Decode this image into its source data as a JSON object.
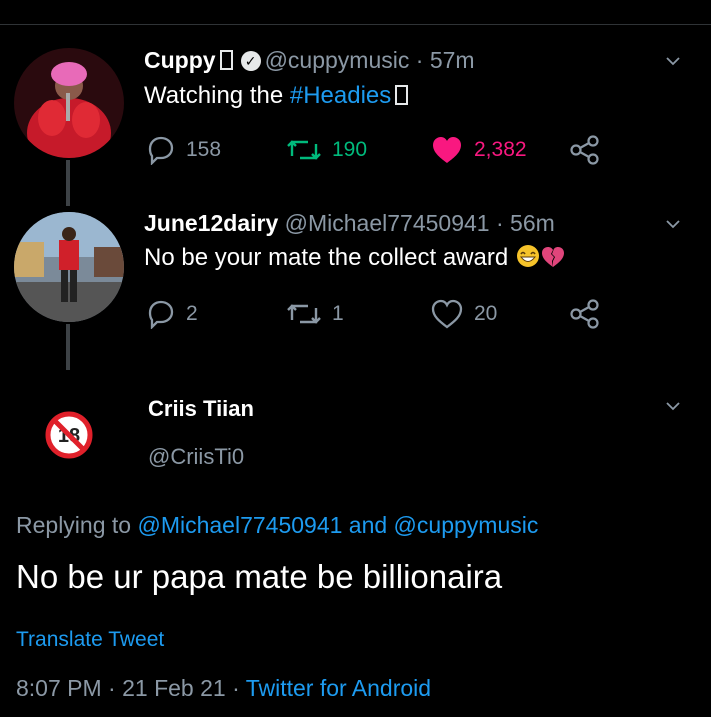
{
  "tweet1": {
    "name": "Cuppy",
    "name_glyph": "",
    "handle": "@cuppymusic",
    "time": "57m",
    "text_prefix": "Watching the ",
    "hashtag": "#Headies",
    "replies": "158",
    "retweets": "190",
    "likes": "2,382",
    "retweet_color": "#00ba7c",
    "like_color": "#f91880"
  },
  "tweet2": {
    "name": "June12dairy",
    "handle": "@Michael77450941",
    "time": "56m",
    "text": "No be your mate the collect award",
    "replies": "2",
    "retweets": "1",
    "likes": "20"
  },
  "tweet3": {
    "name": "Criis Tiian",
    "handle": "@CriisTi0",
    "replying_prefix": "Replying to",
    "replying_users": "@Michael77450941 and @cuppymusic",
    "text": "No be ur papa mate be billionaira",
    "translate": "Translate Tweet",
    "timestamp": "8:07 PM · 21 Feb 21 · ",
    "source": "Twitter for Android"
  },
  "icons": [
    "reply-icon",
    "retweet-icon",
    "like-icon",
    "share-icon",
    "chevron-down-icon",
    "verified-icon"
  ]
}
